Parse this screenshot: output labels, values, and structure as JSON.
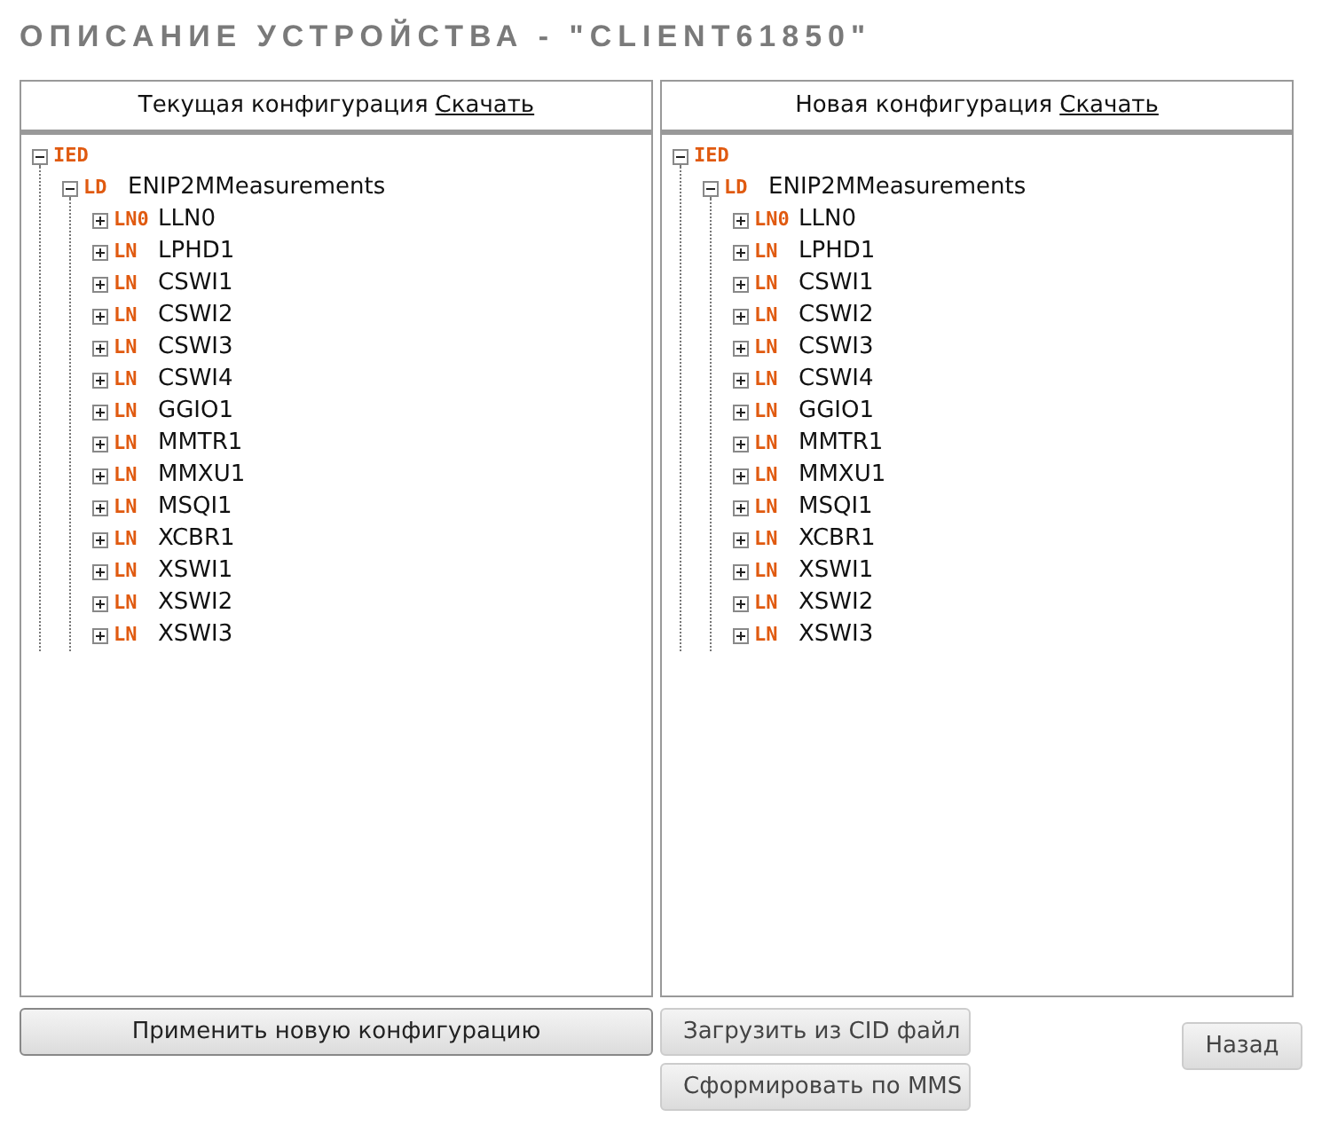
{
  "title": "ОПИСАНИЕ УСТРОЙСТВА - \"CLIENT61850\"",
  "panels": [
    {
      "heading": "Текущая конфигурация",
      "link": "Скачать",
      "tree": [
        {
          "tag": "IED",
          "expanded": true,
          "children": [
            {
              "tag": "LD",
              "name": "ENIP2MMeasurements",
              "expanded": true,
              "children": [
                {
                  "tag": "LN0",
                  "name": "LLN0",
                  "expanded": false
                },
                {
                  "tag": "LN",
                  "name": "LPHD1",
                  "expanded": false
                },
                {
                  "tag": "LN",
                  "name": "CSWI1",
                  "expanded": false
                },
                {
                  "tag": "LN",
                  "name": "CSWI2",
                  "expanded": false
                },
                {
                  "tag": "LN",
                  "name": "CSWI3",
                  "expanded": false
                },
                {
                  "tag": "LN",
                  "name": "CSWI4",
                  "expanded": false
                },
                {
                  "tag": "LN",
                  "name": "GGIO1",
                  "expanded": false
                },
                {
                  "tag": "LN",
                  "name": "MMTR1",
                  "expanded": false
                },
                {
                  "tag": "LN",
                  "name": "MMXU1",
                  "expanded": false
                },
                {
                  "tag": "LN",
                  "name": "MSQI1",
                  "expanded": false
                },
                {
                  "tag": "LN",
                  "name": "XCBR1",
                  "expanded": false
                },
                {
                  "tag": "LN",
                  "name": "XSWI1",
                  "expanded": false
                },
                {
                  "tag": "LN",
                  "name": "XSWI2",
                  "expanded": false
                },
                {
                  "tag": "LN",
                  "name": "XSWI3",
                  "expanded": false
                }
              ]
            }
          ]
        }
      ]
    },
    {
      "heading": "Новая конфигурация",
      "link": "Скачать",
      "tree": [
        {
          "tag": "IED",
          "expanded": true,
          "children": [
            {
              "tag": "LD",
              "name": "ENIP2MMeasurements",
              "expanded": true,
              "children": [
                {
                  "tag": "LN0",
                  "name": "LLN0",
                  "expanded": false
                },
                {
                  "tag": "LN",
                  "name": "LPHD1",
                  "expanded": false
                },
                {
                  "tag": "LN",
                  "name": "CSWI1",
                  "expanded": false
                },
                {
                  "tag": "LN",
                  "name": "CSWI2",
                  "expanded": false
                },
                {
                  "tag": "LN",
                  "name": "CSWI3",
                  "expanded": false
                },
                {
                  "tag": "LN",
                  "name": "CSWI4",
                  "expanded": false
                },
                {
                  "tag": "LN",
                  "name": "GGIO1",
                  "expanded": false
                },
                {
                  "tag": "LN",
                  "name": "MMTR1",
                  "expanded": false
                },
                {
                  "tag": "LN",
                  "name": "MMXU1",
                  "expanded": false
                },
                {
                  "tag": "LN",
                  "name": "MSQI1",
                  "expanded": false
                },
                {
                  "tag": "LN",
                  "name": "XCBR1",
                  "expanded": false
                },
                {
                  "tag": "LN",
                  "name": "XSWI1",
                  "expanded": false
                },
                {
                  "tag": "LN",
                  "name": "XSWI2",
                  "expanded": false
                },
                {
                  "tag": "LN",
                  "name": "XSWI3",
                  "expanded": false
                }
              ]
            }
          ]
        }
      ]
    }
  ],
  "buttons": {
    "apply": "Применить новую конфигурацию",
    "load_cid": "Загрузить из CID файл",
    "build_mms": "Сформировать по MMS",
    "back": "Назад"
  }
}
